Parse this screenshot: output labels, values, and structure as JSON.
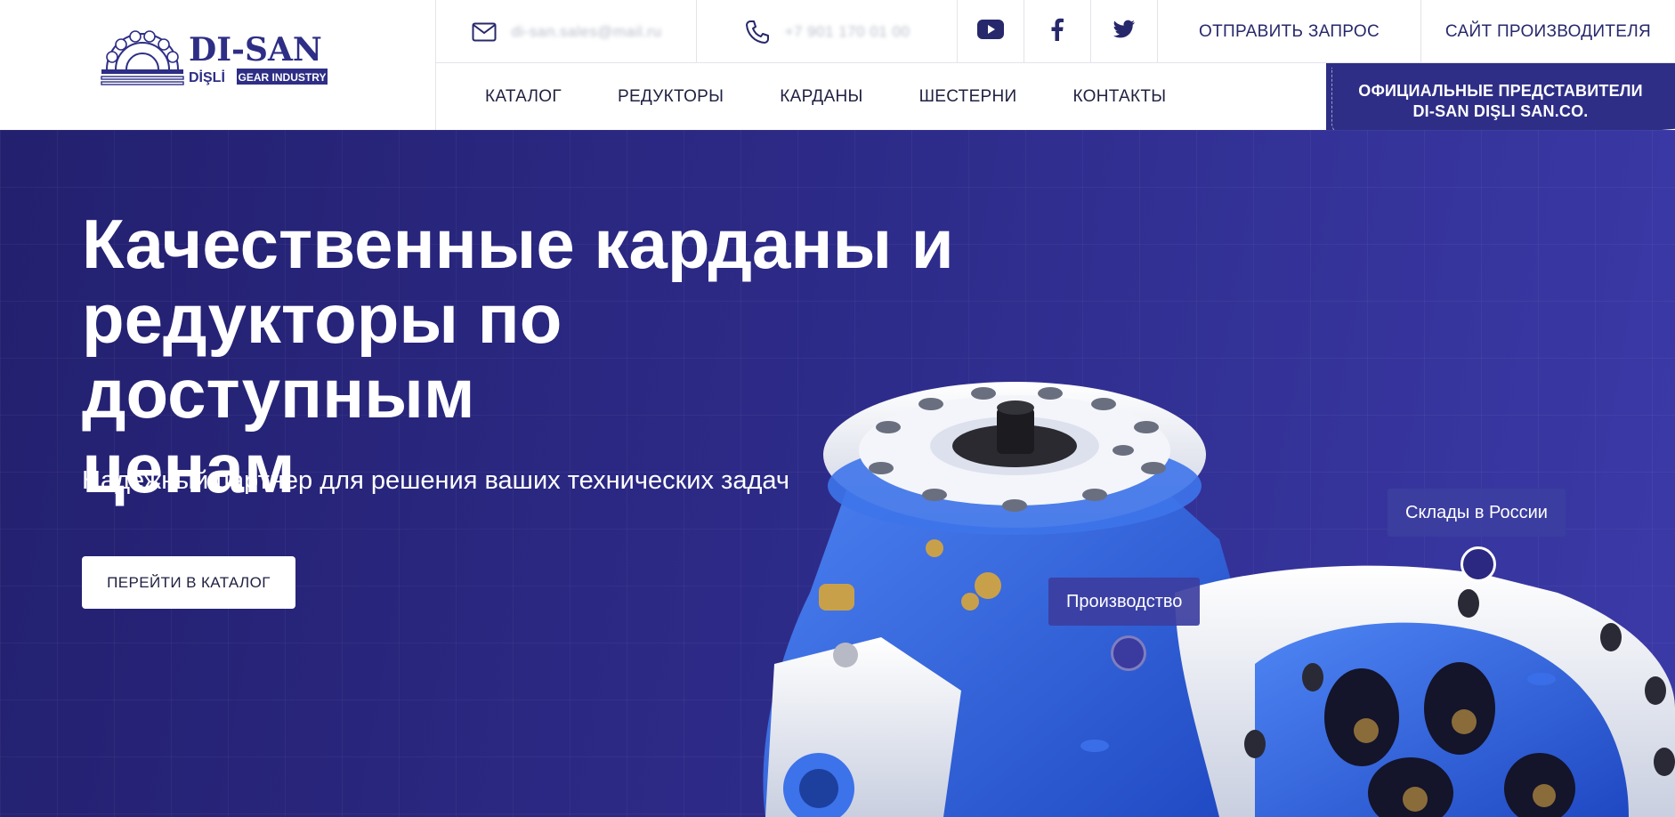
{
  "brand": {
    "name": "DI-SAN",
    "sub_left": "DİŞLİ",
    "sub_right": "GEAR INDUSTRY"
  },
  "topbar": {
    "email": "di-san.sales@mail.ru",
    "phone": "+7 901 170 01 00",
    "social_icons": [
      "youtube-icon",
      "facebook-icon",
      "twitter-icon"
    ],
    "send_request": "ОТПРАВИТЬ ЗАПРОС",
    "manufacturer_site": "САЙТ ПРОИЗВОДИТЕЛЯ"
  },
  "nav": {
    "items": [
      "КАТАЛОГ",
      "РЕДУКТОРЫ",
      "КАРДАНЫ",
      "ШЕСТЕРНИ",
      "КОНТАКТЫ"
    ]
  },
  "badge": {
    "line1": "ОФИЦИАЛЬНЫЕ ПРЕДСТАВИТЕЛИ",
    "line2": "DI-SAN DIŞLI SAN.CO."
  },
  "hero": {
    "title_line1": "Качественные карданы и",
    "title_line2": "редукторы по доступным",
    "title_line3": "ценам",
    "subtitle": "Надежный партнер для решения ваших технических задач",
    "cta": "ПЕРЕЙТИ В КАТАЛОГ",
    "hotspots": [
      "Склады в России",
      "Производство"
    ]
  },
  "colors": {
    "brand": "#2e2e86",
    "hero_bg": "#2c2a86",
    "accent_blue": "#3a6ee8",
    "text_dark": "#1f2040"
  }
}
